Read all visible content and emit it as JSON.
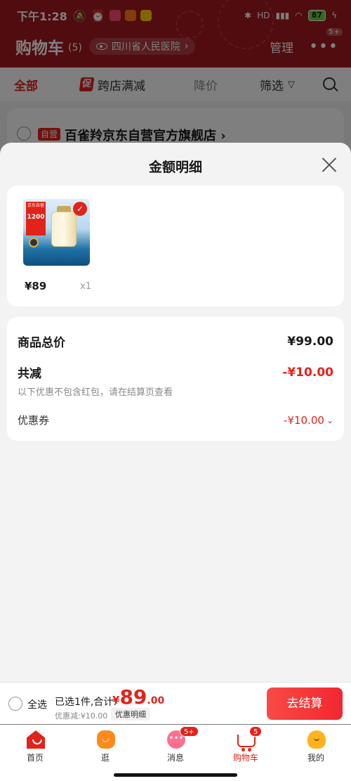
{
  "status_bar": {
    "time": "下午1:28",
    "battery": "87",
    "hd": "HD"
  },
  "header": {
    "title": "购物车",
    "count": "(5)",
    "location": "四川省人民医院",
    "manage": "管理",
    "more_badge": "5+"
  },
  "filters": {
    "all": "全部",
    "promo_tag": "促",
    "cross_store": "跨店满减",
    "price_drop": "降价",
    "filter": "筛选"
  },
  "store": {
    "self_tag": "自营",
    "name": "百雀羚京东自营官方旗舰店 ›"
  },
  "sheet": {
    "title": "金额明细",
    "product": {
      "price": "¥89",
      "qty": "x1",
      "thumb_brand": "京东自营",
      "thumb_number": "1200"
    },
    "total_label": "商品总价",
    "total_value": "¥99.00",
    "reduce_label": "共减",
    "reduce_value": "-¥10.00",
    "note": "以下优惠不包含红包，请在结算页查看",
    "coupon_label": "优惠券",
    "coupon_value": "-¥10.00"
  },
  "checkout": {
    "select_all": "全选",
    "selected": "已选1件,合计:",
    "currency": "¥",
    "amount_int": "89",
    "amount_dec": ".00",
    "discount": "优惠减:¥10.00",
    "detail_btn": "优惠明细",
    "pay": "去结算"
  },
  "tabs": [
    {
      "label": "首页"
    },
    {
      "label": "逛"
    },
    {
      "label": "消息",
      "badge": "5+"
    },
    {
      "label": "购物车",
      "badge": "5"
    },
    {
      "label": "我的"
    }
  ],
  "colors": {
    "brand_red": "#e2231a",
    "header_red": "#a3191f"
  }
}
